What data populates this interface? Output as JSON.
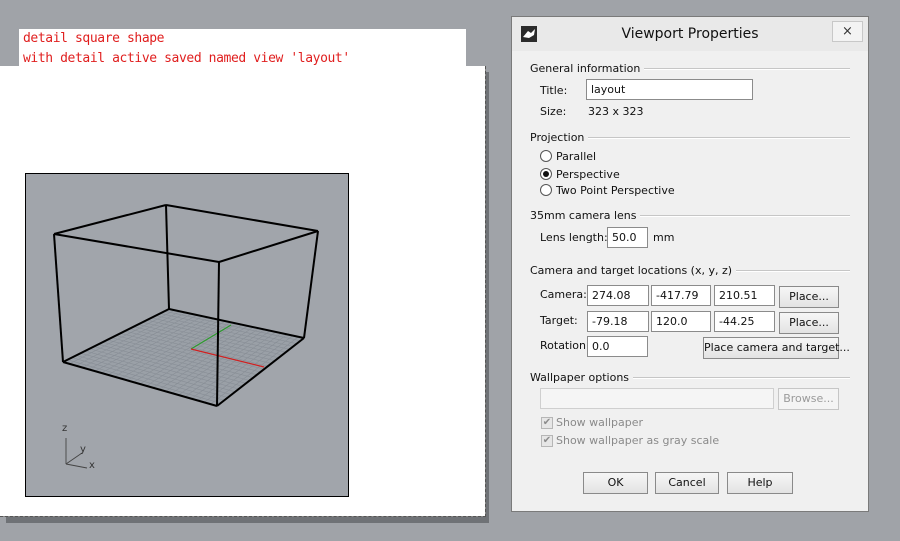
{
  "annotation": {
    "line1": "detail square shape",
    "line2": "with detail active saved named view 'layout'"
  },
  "detail": {
    "axis_z": "z",
    "axis_y": "y",
    "axis_x": "x"
  },
  "dialog": {
    "title": "Viewport Properties",
    "close": "×",
    "general": {
      "heading": "General information",
      "title_label": "Title:",
      "title_value": "layout",
      "size_label": "Size:",
      "size_value": "323 x 323"
    },
    "projection": {
      "heading": "Projection",
      "options": [
        "Parallel",
        "Perspective",
        "Two Point Perspective"
      ],
      "selected": "Perspective"
    },
    "lens": {
      "heading": "35mm camera lens",
      "label": "Lens length:",
      "value": "50.0",
      "unit": "mm"
    },
    "camera": {
      "heading": "Camera and target locations (x, y, z)",
      "camera_label": "Camera:",
      "camera_values": [
        "274.08",
        "-417.79",
        "210.51"
      ],
      "target_label": "Target:",
      "target_values": [
        "-79.18",
        "120.0",
        "-44.25"
      ],
      "rotation_label": "Rotation:",
      "rotation_value": "0.0",
      "place_label": "Place...",
      "place_both_label": "Place camera and target..."
    },
    "wallpaper": {
      "heading": "Wallpaper options",
      "path_value": "",
      "browse_label": "Browse...",
      "show_label": "Show wallpaper",
      "gray_label": "Show wallpaper as gray scale"
    },
    "buttons": {
      "ok": "OK",
      "cancel": "Cancel",
      "help": "Help"
    }
  }
}
